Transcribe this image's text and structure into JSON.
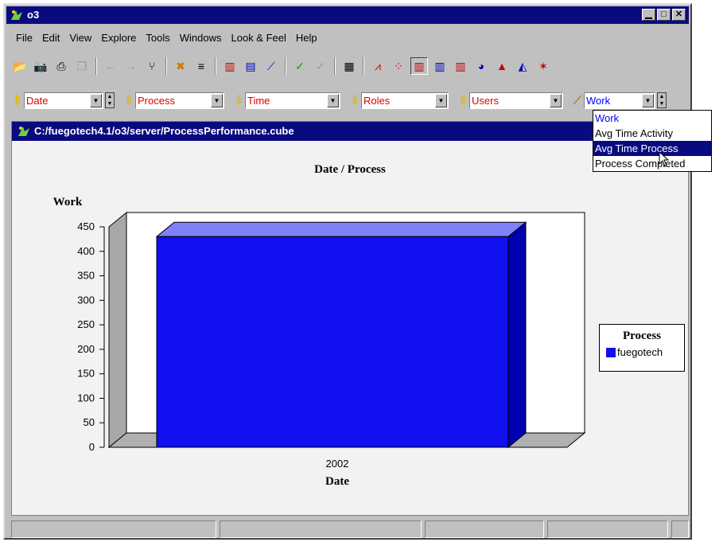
{
  "window": {
    "title": "o3"
  },
  "menu": [
    "File",
    "Edit",
    "View",
    "Explore",
    "Tools",
    "Windows",
    "Look & Feel",
    "Help"
  ],
  "dimensions": [
    {
      "name": "date",
      "value": "Date"
    },
    {
      "name": "process",
      "value": "Process"
    },
    {
      "name": "time",
      "value": "Time"
    },
    {
      "name": "roles",
      "value": "Roles"
    },
    {
      "name": "users",
      "value": "Users"
    }
  ],
  "measure": {
    "value": "Work",
    "options": [
      "Work",
      "Avg Time Activity",
      "Avg Time Process",
      "Process Completed"
    ],
    "highlighted": "Avg Time Process"
  },
  "view": {
    "title": "C:/fuegotech4.1/o3/server/ProcessPerformance.cube"
  },
  "chart_data": {
    "type": "bar",
    "title": "Date / Process",
    "xlabel": "Date",
    "ylabel": "Work",
    "categories": [
      "2002"
    ],
    "series": [
      {
        "name": "fuegotech",
        "values": [
          430
        ],
        "color": "#1010f0"
      }
    ],
    "ylim": [
      0,
      450
    ],
    "yticks": [
      0,
      50,
      100,
      150,
      200,
      250,
      300,
      350,
      400,
      450
    ],
    "legend_title": "Process",
    "legend_position": "right"
  }
}
